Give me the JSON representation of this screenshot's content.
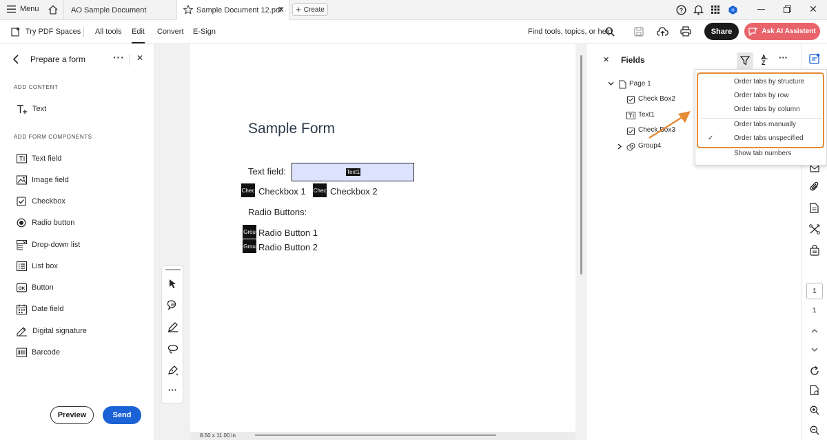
{
  "tabbar": {
    "menu_label": "Menu",
    "tab1": "AO Sample Document",
    "tab2": "Sample Document 12.pdf",
    "create_label": "Create"
  },
  "toolbar": {
    "try_pdf_spaces": "Try PDF Spaces",
    "all_tools": "All tools",
    "edit": "Edit",
    "convert": "Convert",
    "esign": "E-Sign",
    "find_placeholder": "Find tools, topics, or help",
    "share": "Share",
    "ask_ai": "Ask AI Assistent"
  },
  "left_panel": {
    "title": "Prepare a form",
    "add_content_heading": "ADD CONTENT",
    "text_item": "Text",
    "add_form_heading": "ADD FORM COMPONENTS",
    "components": [
      {
        "label": "Text field",
        "icon": "text-field-icon"
      },
      {
        "label": "Image field",
        "icon": "image-field-icon"
      },
      {
        "label": "Checkbox",
        "icon": "checkbox-icon"
      },
      {
        "label": "Radio button",
        "icon": "radio-button-icon"
      },
      {
        "label": "Drop-down list",
        "icon": "dropdown-list-icon"
      },
      {
        "label": "List box",
        "icon": "list-box-icon"
      },
      {
        "label": "Button",
        "icon": "button-icon"
      },
      {
        "label": "Date field",
        "icon": "date-field-icon"
      },
      {
        "label": "Digital signature",
        "icon": "digital-signature-icon"
      },
      {
        "label": "Barcode",
        "icon": "barcode-icon"
      }
    ],
    "preview": "Preview",
    "send": "Send"
  },
  "document": {
    "title": "Sample Form",
    "text_field_label": "Text field:",
    "text_field_value": "Text1",
    "checkbox_tag": "Chec",
    "checkbox1_label": "Checkbox 1",
    "checkbox2_label": "Checkbox 2",
    "radio_heading": "Radio Buttons:",
    "radio_tag": "Grou",
    "radio1_label": "Radio Button 1",
    "radio2_label": "Radio Button 2",
    "page_size": "8.50 x 11.00 in"
  },
  "fields_panel": {
    "title": "Fields",
    "sort_glyph_top": "A",
    "sort_glyph_bottom": "Z",
    "tree": [
      {
        "label": "Page 1"
      },
      {
        "label": "Check Box2"
      },
      {
        "label": "Text1"
      },
      {
        "label": "Check Box3"
      },
      {
        "label": "Group4"
      }
    ]
  },
  "menu": {
    "items": [
      "Order tabs by structure",
      "Order tabs by row",
      "Order tabs by column",
      "Order tabs manually",
      "Order tabs unspecified",
      "Show tab numbers"
    ],
    "checked": "Order tabs unspecified"
  },
  "right_rail": {
    "page_number": "1",
    "page_total": "1"
  },
  "colors": {
    "accent_blue": "#1a62d6",
    "ai_button": "#e8646a",
    "highlight_orange": "#e58a35",
    "text_field_fill": "#dde2ff"
  }
}
